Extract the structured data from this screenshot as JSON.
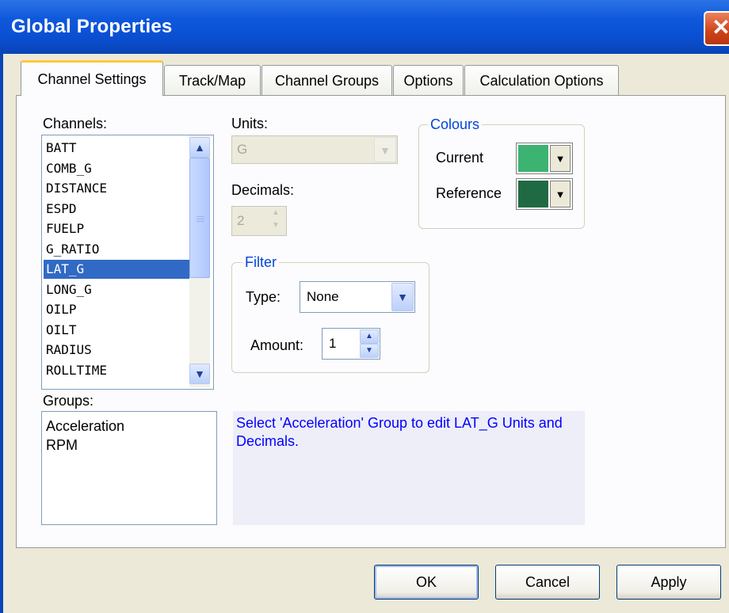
{
  "window": {
    "title": "Global Properties",
    "close_glyph": "✕"
  },
  "tabs": [
    {
      "label": "Channel Settings",
      "active": true
    },
    {
      "label": "Track/Map"
    },
    {
      "label": "Channel Groups"
    },
    {
      "label": "Options"
    },
    {
      "label": "Calculation Options"
    }
  ],
  "channels": {
    "label": "Channels:",
    "items": [
      "BATT",
      "COMB_G",
      "DISTANCE",
      "ESPD",
      "FUELP",
      "G_RATIO",
      "LAT_G",
      "LONG_G",
      "OILP",
      "OILT",
      "RADIUS",
      "ROLLTIME"
    ],
    "selected": "LAT_G"
  },
  "groups": {
    "label": "Groups:",
    "items": [
      "Acceleration",
      "RPM"
    ]
  },
  "units": {
    "label": "Units:",
    "value": "G"
  },
  "decimals": {
    "label": "Decimals:",
    "value": "2"
  },
  "colours": {
    "title": "Colours",
    "current_label": "Current",
    "current_color": "#3cb371",
    "reference_label": "Reference",
    "reference_color": "#1f6a43"
  },
  "filter": {
    "title": "Filter",
    "type_label": "Type:",
    "type_value": "None",
    "amount_label": "Amount:",
    "amount_value": "1"
  },
  "message": "Select 'Acceleration' Group to edit LAT_G Units and Decimals.",
  "buttons": {
    "ok": "OK",
    "cancel": "Cancel",
    "apply": "Apply"
  }
}
